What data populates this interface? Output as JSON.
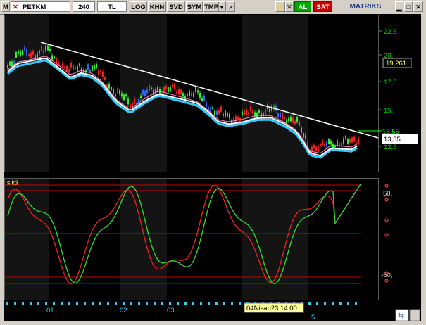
{
  "toolbar": {
    "menu": "M",
    "symbol": "PETKM",
    "period": "240",
    "currency": "TL",
    "buttons": [
      "LOG",
      "KHN",
      "SVD",
      "SYM",
      "TMP"
    ],
    "buy": "AL",
    "sell": "SAT",
    "brand": "MATRIKS"
  },
  "price_axis": {
    "ticks": [
      "22,5",
      "20,",
      "17,5",
      "15,",
      "12,5"
    ],
    "current_value": "19,261",
    "last_green": "13,55",
    "last_white": "13,35"
  },
  "indicator": {
    "name": "sjk3",
    "ticks": [
      "50,",
      "-50,"
    ]
  },
  "time_axis": {
    "labels": [
      "01",
      "02",
      "03",
      "5"
    ],
    "cursor_label": "04Nisan23 14:00"
  },
  "colors": {
    "trendline": "#ffffff",
    "ma_cyan": "#33ccff",
    "ma_white": "#ffffff",
    "oscillator_green": "#33dd33",
    "oscillator_red": "#ee2222",
    "level_lines": "#cc0000",
    "axis_text": "#00cc00"
  }
}
